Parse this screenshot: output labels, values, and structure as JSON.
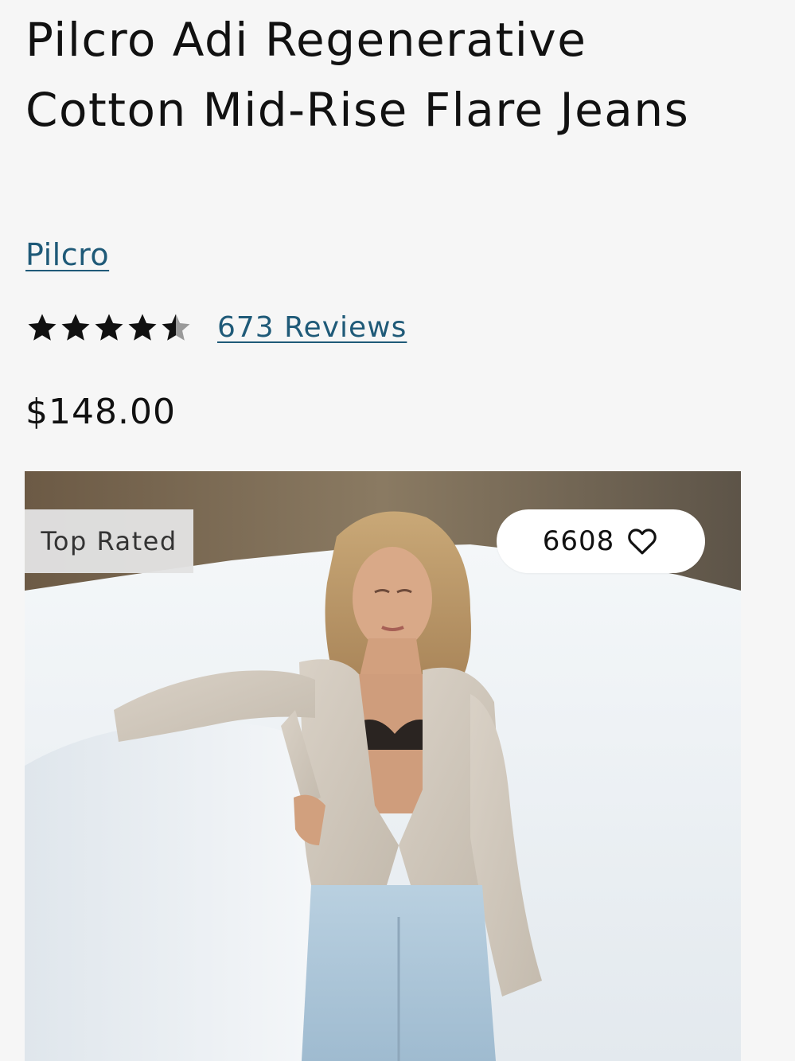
{
  "product": {
    "title": "Pilcro Adi Regenerative Cotton Mid-Rise Flare Jeans",
    "brand": "Pilcro",
    "rating": 4.5,
    "rating_max": 5,
    "reviews_label": "673 Reviews",
    "price": "$148.00"
  },
  "image": {
    "badge": "Top Rated",
    "favorites_count": "6608",
    "favorite_icon": "heart-outline-icon",
    "star_icon": "star-icon"
  },
  "colors": {
    "link": "#1f5a78",
    "star": "#111111",
    "star_empty": "#9a9a9a",
    "badge_bg": "#e2e2e2"
  }
}
